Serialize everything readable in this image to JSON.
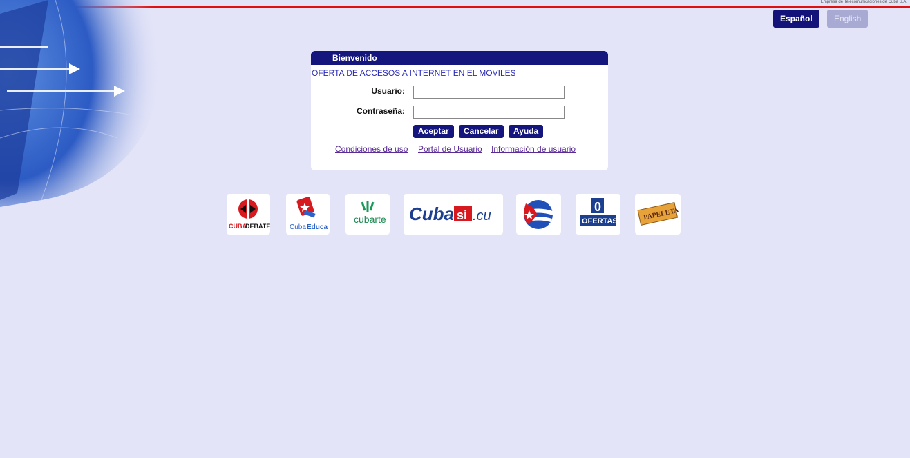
{
  "header": {
    "tiny_text": "Empresa de Telecomunicaciones de Cuba S.A."
  },
  "language": {
    "spanish": "Español",
    "english": "English"
  },
  "panel": {
    "title": "Bienvenido",
    "offer_link": "OFERTA DE ACCESOS A INTERNET EN EL MOVILES",
    "username_label": "Usuario:",
    "username_value": "",
    "password_label": "Contraseña:",
    "password_value": "",
    "buttons": {
      "accept": "Aceptar",
      "cancel": "Cancelar",
      "help": "Ayuda"
    },
    "links": {
      "terms": "Condiciones de uso",
      "portal": "Portal de Usuario",
      "info": "Información de usuario"
    }
  },
  "logos": {
    "cubadebate_a": "CUBA",
    "cubadebate_b": "DEBATE",
    "cubaeduca_a": "Cuba",
    "cubaeduca_b": "Educa",
    "cubarte": "cubarte",
    "cubasi_a": "Cuba",
    "cubasi_b": "si",
    "cubasi_c": ".cu",
    "ofertas_digit": "0",
    "ofertas": "OFERTAS",
    "papeleta": "PAPELETA"
  },
  "colors": {
    "navy": "#15157e",
    "accent_red": "#e01010",
    "background": "#e3e4f8"
  }
}
